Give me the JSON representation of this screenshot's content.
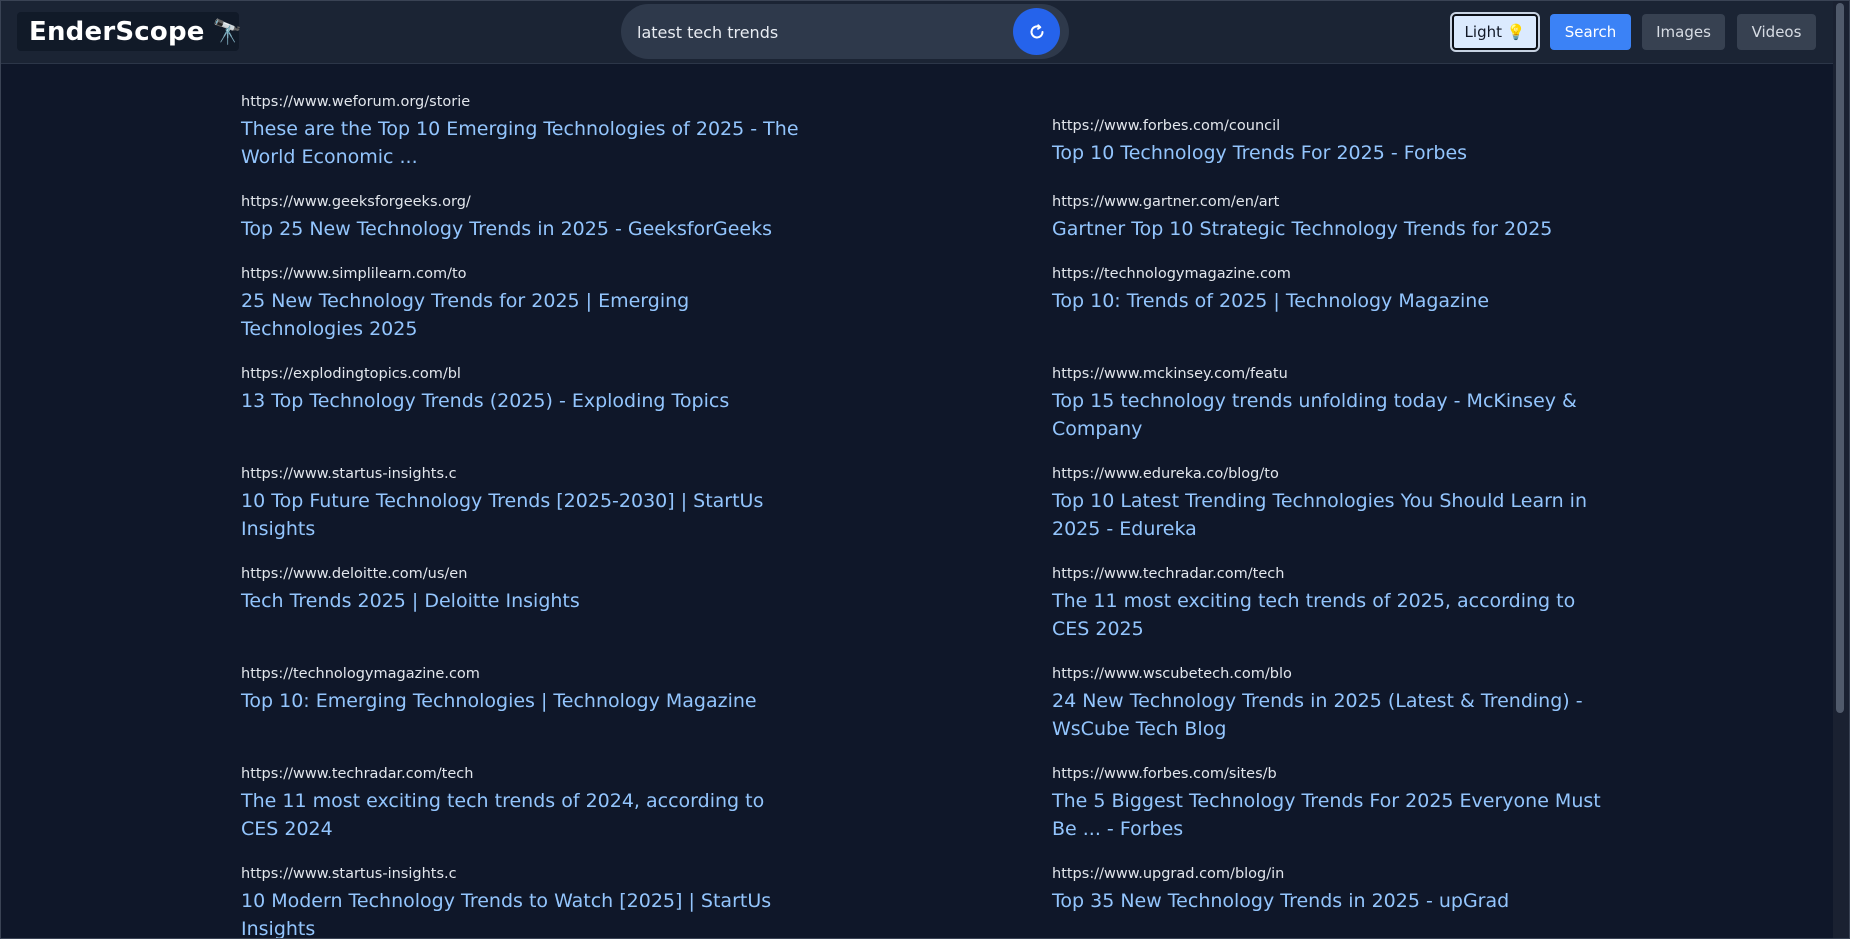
{
  "header": {
    "logo_text": "EnderScope",
    "logo_emoji": "🔭",
    "search_value": "latest tech trends",
    "buttons": {
      "light": "Light 💡",
      "search": "Search",
      "images": "Images",
      "videos": "Videos"
    }
  },
  "results": [
    {
      "url": "https://www.weforum.org/storie",
      "title": "These are the Top 10 Emerging Technologies of 2025 - The World Economic ..."
    },
    {
      "url": "https://www.forbes.com/council",
      "title": "Top 10 Technology Trends For 2025 - Forbes"
    },
    {
      "url": "https://www.geeksforgeeks.org/",
      "title": "Top 25 New Technology Trends in 2025 - GeeksforGeeks"
    },
    {
      "url": "https://www.gartner.com/en/art",
      "title": "Gartner Top 10 Strategic Technology Trends for 2025"
    },
    {
      "url": "https://www.simplilearn.com/to",
      "title": "25 New Technology Trends for 2025 | Emerging Technologies 2025"
    },
    {
      "url": "https://technologymagazine.com",
      "title": "Top 10: Trends of 2025 | Technology Magazine"
    },
    {
      "url": "https://explodingtopics.com/bl",
      "title": "13 Top Technology Trends (2025) - Exploding Topics"
    },
    {
      "url": "https://www.mckinsey.com/featu",
      "title": "Top 15 technology trends unfolding today - McKinsey & Company"
    },
    {
      "url": "https://www.startus-insights.c",
      "title": "10 Top Future Technology Trends [2025-2030] | StartUs Insights"
    },
    {
      "url": "https://www.edureka.co/blog/to",
      "title": "Top 10 Latest Trending Technologies You Should Learn in 2025 - Edureka"
    },
    {
      "url": "https://www.deloitte.com/us/en",
      "title": "Tech Trends 2025 | Deloitte Insights"
    },
    {
      "url": "https://www.techradar.com/tech",
      "title": "The 11 most exciting tech trends of 2025, according to CES 2025"
    },
    {
      "url": "https://technologymagazine.com",
      "title": "Top 10: Emerging Technologies | Technology Magazine"
    },
    {
      "url": "https://www.wscubetech.com/blo",
      "title": "24 New Technology Trends in 2025 (Latest & Trending) - WsCube Tech Blog"
    },
    {
      "url": "https://www.techradar.com/tech",
      "title": "The 11 most exciting tech trends of 2024, according to CES 2024"
    },
    {
      "url": "https://www.forbes.com/sites/b",
      "title": "The 5 Biggest Technology Trends For 2025 Everyone Must Be ... - Forbes"
    },
    {
      "url": "https://www.startus-insights.c",
      "title": "10 Modern Technology Trends to Watch [2025] | StartUs Insights"
    },
    {
      "url": "https://www.upgrad.com/blog/in",
      "title": "Top 35 New Technology Trends in 2025 - upGrad"
    }
  ]
}
